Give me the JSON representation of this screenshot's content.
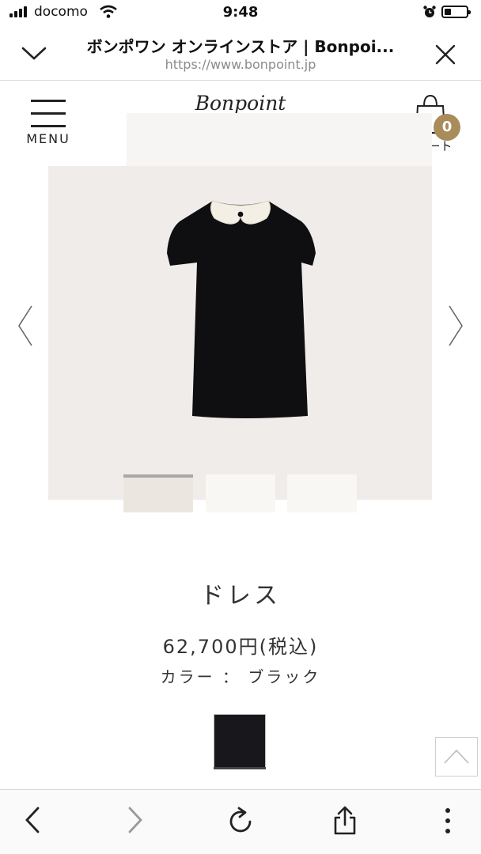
{
  "status_bar": {
    "carrier": "docomo",
    "time": "9:48",
    "battery_level": 0.3
  },
  "browser": {
    "page_title": "ボンポワン オンラインストア | Bonpoi...",
    "url": "https://www.bonpoint.jp"
  },
  "header": {
    "menu_label": "MENU",
    "logo_text": "Bonpoint",
    "cart_count": "0",
    "cart_label": "カート"
  },
  "product": {
    "name": "ドレス",
    "price": "62,700円(税込)",
    "color_line": "カラー ： ブラック",
    "swatch_color": "#18181c"
  },
  "colors": {
    "accent": "#a88c5a",
    "gallery_bg": "#f0ece9"
  },
  "icons": [
    "signal-icon",
    "wifi-icon",
    "alarm-icon",
    "battery-icon",
    "chevron-down-icon",
    "close-icon",
    "hamburger-icon",
    "cherry-icon",
    "shopping-bag-icon",
    "arrow-left-icon",
    "arrow-right-icon",
    "scroll-top-icon",
    "back-icon",
    "forward-icon",
    "reload-icon",
    "share-icon",
    "more-icon"
  ]
}
